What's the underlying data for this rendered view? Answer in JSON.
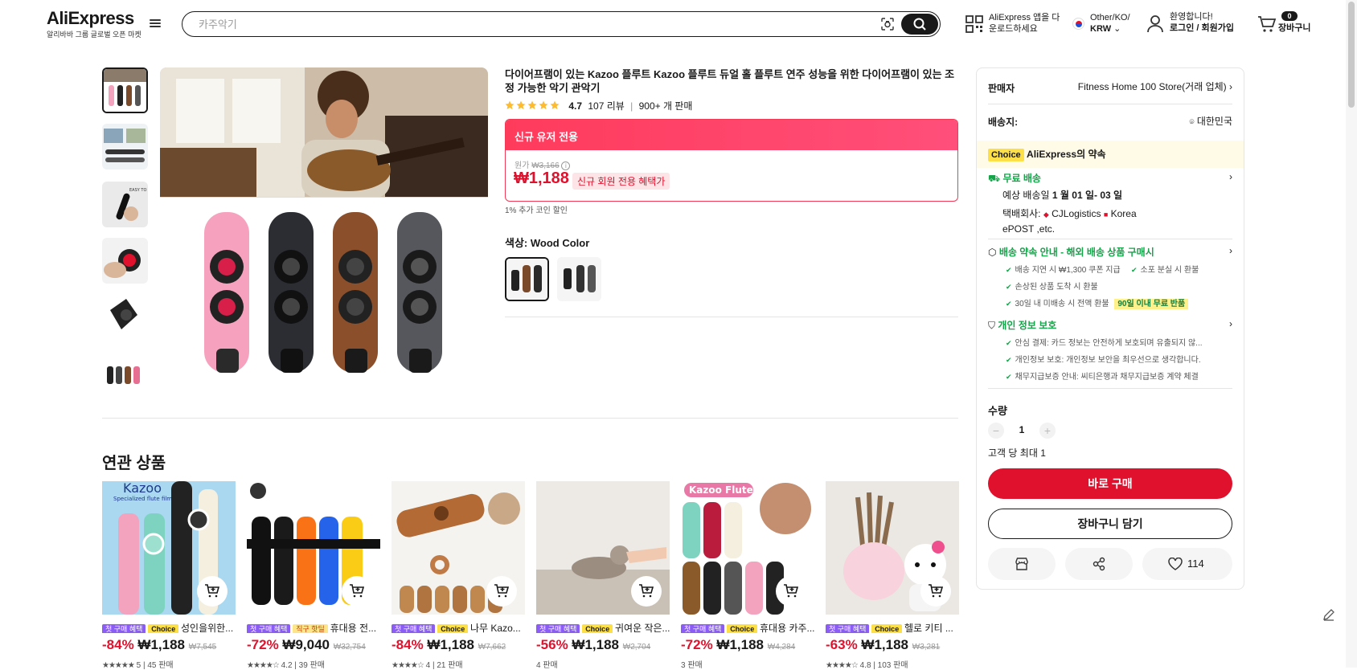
{
  "header": {
    "logo": "AliExpress",
    "logo_sub": "알리바바 그룹 글로벌 오픈 마켓",
    "search_placeholder": "카주악기",
    "app_line1": "AliExpress 앱을 다",
    "app_line2": "운로드하세요",
    "locale_line1": "Other/KO/",
    "locale_line2": "KRW",
    "welcome": "환영합니다!",
    "login": "로그인 / 회원가입",
    "cart_count": "0",
    "cart_label": "장바구니"
  },
  "product": {
    "title": "다이어프램이 있는 Kazoo 플루트 Kazoo 플루트 듀얼 홀 플루트 연주 성능을 위한 다이어프램이 있는 조정 가능한 악기 관악기",
    "rating": "4.7",
    "reviews": "107 리뷰",
    "sold": "900+ 개 판매",
    "promo_title": "신규 유저 전용",
    "orig_label": "원가",
    "orig_price": "₩3,166",
    "price": "₩1,188",
    "price_badge": "신규 회원 전용 혜택가",
    "coin": "1% 추가 코인 할인",
    "color_label": "색상: Wood Color"
  },
  "related": {
    "title": "연관 상품",
    "items": [
      {
        "tag1": "첫 구매 혜택",
        "tag2": "Choice",
        "name": "성인을위한...",
        "discount": "-84%",
        "price": "₩1,188",
        "orig": "₩7,545",
        "sold": "5 | 45 판매"
      },
      {
        "tag1": "첫 구매 혜택",
        "tag2": "직구 핫딜",
        "name": "휴대용 전...",
        "discount": "-72%",
        "price": "₩9,040",
        "orig": "₩32,754",
        "sold": "4.2 | 39 판매"
      },
      {
        "tag1": "첫 구매 혜택",
        "tag2": "Choice",
        "name": "나무 Kazo...",
        "discount": "-84%",
        "price": "₩1,188",
        "orig": "₩7,662",
        "sold": "4 | 21 판매"
      },
      {
        "tag1": "첫 구매 혜택",
        "tag2": "Choice",
        "name": "귀여운 작은...",
        "discount": "-56%",
        "price": "₩1,188",
        "orig": "₩2,704",
        "sold": "4 판매"
      },
      {
        "tag1": "첫 구매 혜택",
        "tag2": "Choice",
        "name": "휴대용 카주...",
        "discount": "-72%",
        "price": "₩1,188",
        "orig": "₩4,284",
        "sold": "3 판매"
      },
      {
        "tag1": "첫 구매 혜택",
        "tag2": "Choice",
        "name": "헬로 키티 ...",
        "discount": "-63%",
        "price": "₩1,188",
        "orig": "₩3,281",
        "sold": "4.8 | 103 판매"
      }
    ]
  },
  "side": {
    "seller_label": "판매자",
    "seller_name": "Fitness Home 100 Store(거래 업체)",
    "ship_label": "배송지:",
    "ship_to": "대한민국",
    "choice_badge": "Choice",
    "choice_text": "AliExpress의 약속",
    "free_ship": "무료 배송",
    "eta_prefix": "예상 배송일",
    "eta": "1 월 01 일- 03 일",
    "carrier_label": "택배회사:",
    "carrier1": "CJLogistics",
    "carrier2": "Korea",
    "carrier3": "ePOST ,etc.",
    "promise_title": "배송 약속 안내 - 해외 배송 상품 구매시",
    "promise1": "배송 지연 시 ₩1,300 쿠폰 지급",
    "promise2": "소포 분실 시 환불",
    "promise3": "손상된 상품 도착 시 환불",
    "promise4": "30일 내 미배송 시 전액 환불",
    "promise_badge": "90일 이내 무료 반품",
    "privacy_title": "개인 정보 보호",
    "privacy1": "안심 결제: 카드 정보는 안전하게 보호되며 유출되지 않...",
    "privacy2": "개인정보 보호: 개인정보 보안을 최우선으로 생각합니다.",
    "privacy3": "채무지급보증 안내: 씨티은행과 채무지급보증 계약 체결",
    "qty_label": "수량",
    "qty": "1",
    "qty_limit": "고객 당 최대 1",
    "buy_now": "바로 구매",
    "add_cart": "장바구니 담기",
    "wish_count": "114"
  }
}
